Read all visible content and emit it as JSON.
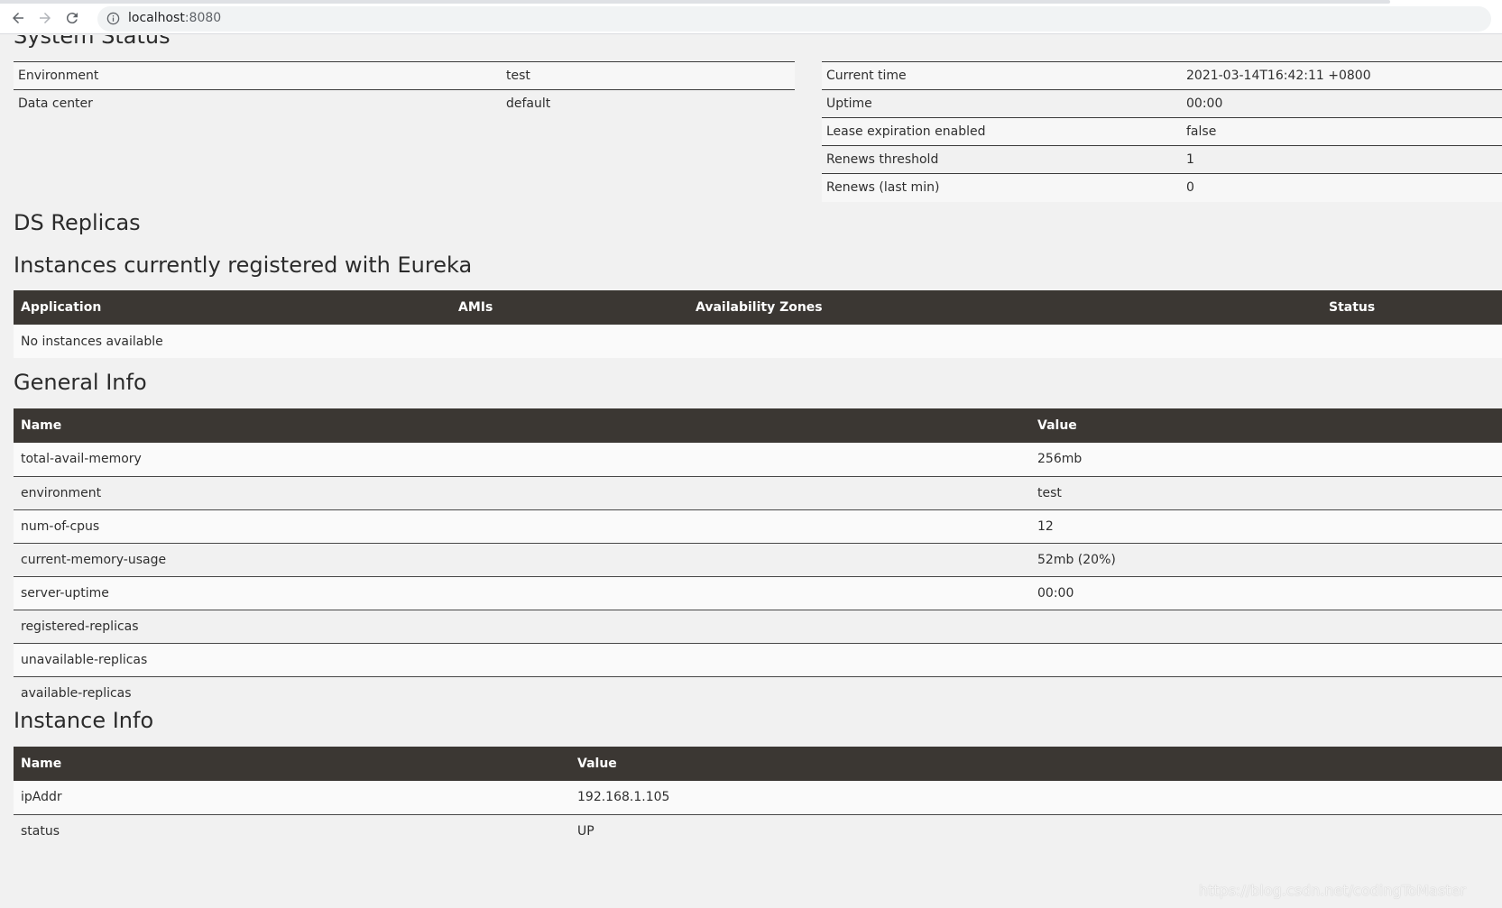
{
  "browser": {
    "url_host": "localhost",
    "url_port": ":8080",
    "icons": [
      "back-arrow-icon",
      "forward-arrow-icon",
      "reload-icon",
      "info-icon"
    ]
  },
  "system_status": {
    "heading": "System Status",
    "left": [
      {
        "label": "Environment",
        "value": "test"
      },
      {
        "label": "Data center",
        "value": "default"
      }
    ],
    "right": [
      {
        "label": "Current time",
        "value": "2021-03-14T16:42:11 +0800"
      },
      {
        "label": "Uptime",
        "value": "00:00"
      },
      {
        "label": "Lease expiration enabled",
        "value": "false"
      },
      {
        "label": "Renews threshold",
        "value": "1"
      },
      {
        "label": "Renews (last min)",
        "value": "0"
      }
    ]
  },
  "ds_replicas": {
    "heading": "DS Replicas"
  },
  "instances": {
    "heading": "Instances currently registered with Eureka",
    "columns": [
      "Application",
      "AMIs",
      "Availability Zones",
      "Status"
    ],
    "empty_text": "No instances available"
  },
  "general_info": {
    "heading": "General Info",
    "columns": [
      "Name",
      "Value"
    ],
    "rows": [
      {
        "name": "total-avail-memory",
        "value": "256mb"
      },
      {
        "name": "environment",
        "value": "test"
      },
      {
        "name": "num-of-cpus",
        "value": "12"
      },
      {
        "name": "current-memory-usage",
        "value": "52mb (20%)"
      },
      {
        "name": "server-uptime",
        "value": "00:00"
      },
      {
        "name": "registered-replicas",
        "value": ""
      },
      {
        "name": "unavailable-replicas",
        "value": ""
      },
      {
        "name": "available-replicas",
        "value": ""
      }
    ]
  },
  "instance_info": {
    "heading": "Instance Info",
    "columns": [
      "Name",
      "Value"
    ],
    "rows": [
      {
        "name": "ipAddr",
        "value": "192.168.1.105"
      },
      {
        "name": "status",
        "value": "UP"
      }
    ]
  },
  "watermark": "https://blog.csdn.net/codingToMaster"
}
